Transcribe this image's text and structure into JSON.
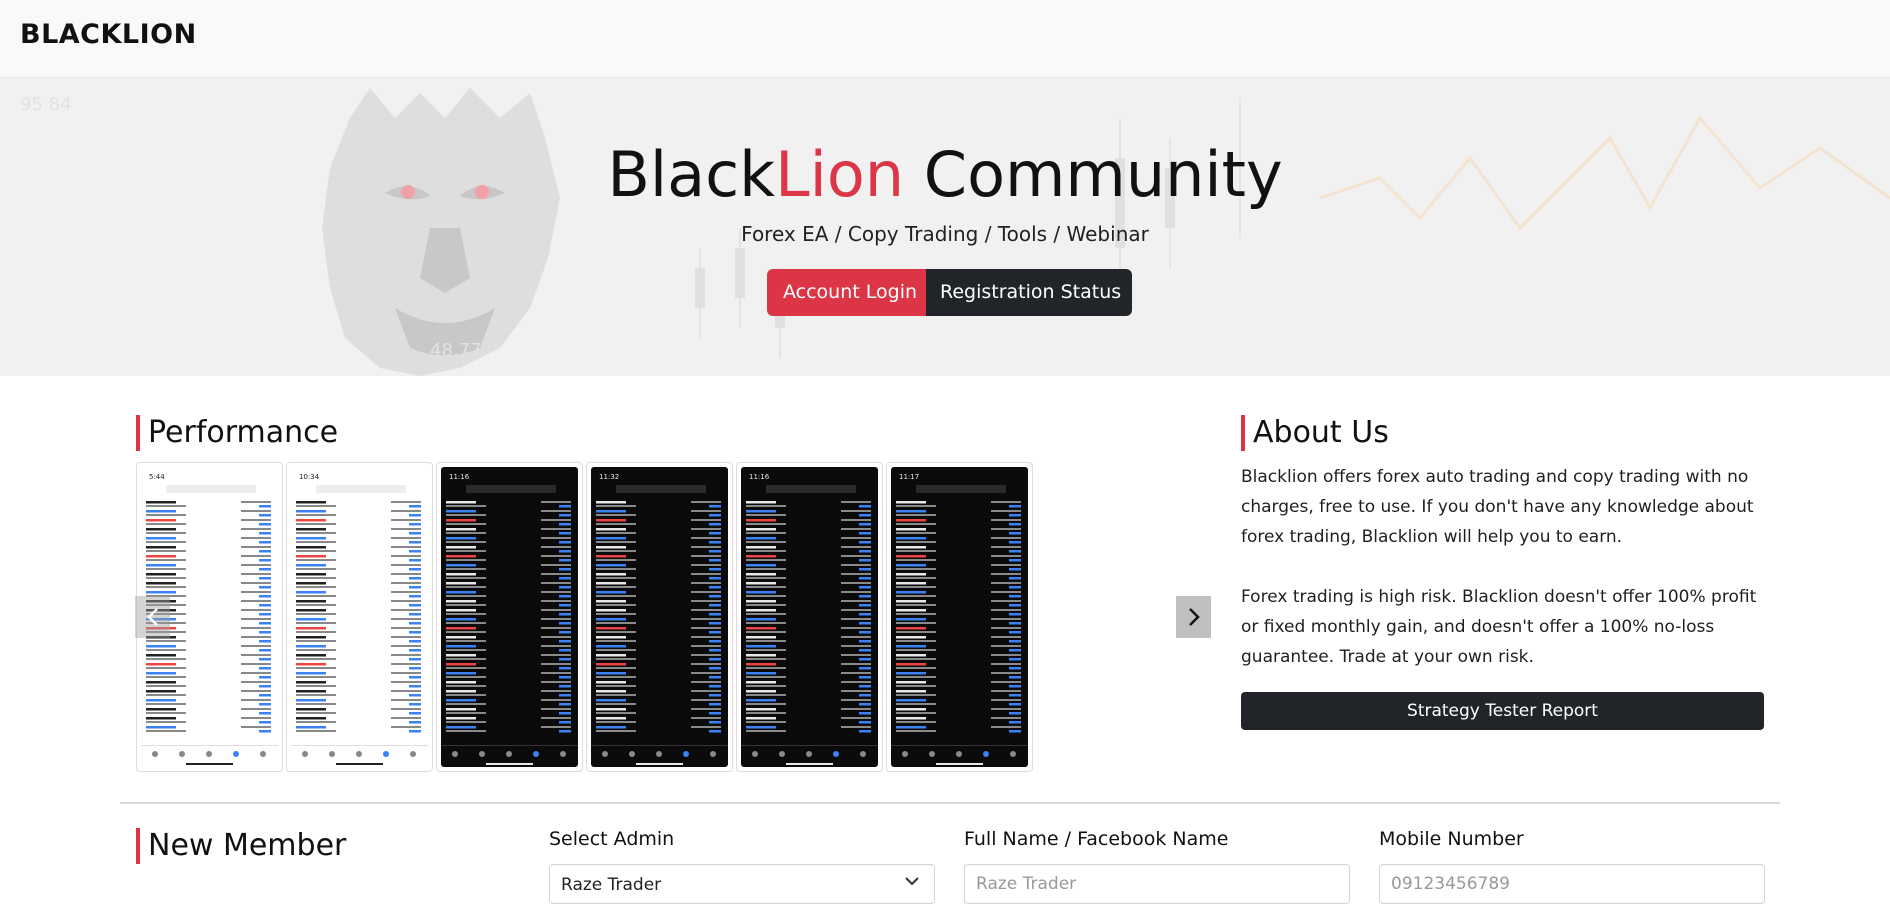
{
  "navbar": {
    "brand": "BLACKLION"
  },
  "hero": {
    "title_part1": "Black",
    "title_accent": "Lion",
    "title_part2": " Community",
    "subtitle": "Forex EA / Copy Trading / Tools / Webinar",
    "login_button": "Account Login",
    "status_button": "Registration Status",
    "background_text_1": "95 84",
    "background_text_2": "48.77"
  },
  "performance": {
    "heading": "Performance",
    "screenshots": [
      {
        "theme": "light",
        "time": "5:44"
      },
      {
        "theme": "light",
        "time": "10:34"
      },
      {
        "theme": "dark",
        "time": "11:16"
      },
      {
        "theme": "dark",
        "time": "11:32"
      },
      {
        "theme": "dark",
        "time": "11:16"
      },
      {
        "theme": "dark",
        "time": "11:17"
      }
    ]
  },
  "about": {
    "heading": "About Us",
    "paragraph1": "Blacklion offers forex auto trading and copy trading with no charges, free to use. If you don't have any knowledge about forex trading, Blacklion will help you to earn.",
    "paragraph2": "Forex trading is high risk. Blacklion doesn't offer 100% profit or fixed monthly gain, and doesn't offer a 100% no-loss guarantee. Trade at your own risk.",
    "strategy_button": "Strategy Tester Report"
  },
  "new_member": {
    "heading": "New Member",
    "select_admin_label": "Select Admin",
    "select_admin_value": "Raze Trader",
    "full_name_label": "Full Name / Facebook Name",
    "full_name_placeholder": "Raze Trader",
    "mobile_label": "Mobile Number",
    "mobile_placeholder": "09123456789"
  },
  "colors": {
    "accent": "#dc3545",
    "dark": "#212529"
  }
}
